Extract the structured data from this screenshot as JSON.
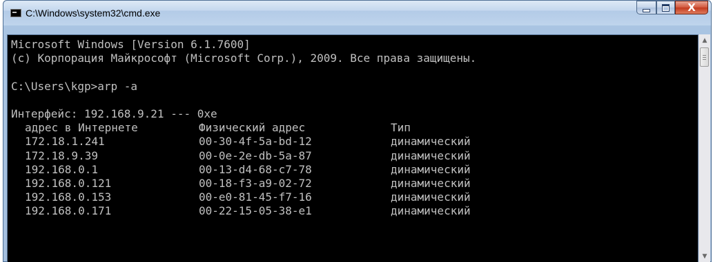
{
  "window": {
    "title": "C:\\Windows\\system32\\cmd.exe",
    "controls": {
      "minimize": "minimize",
      "maximize": "maximize",
      "close": "X"
    }
  },
  "console": {
    "lines": [
      "Microsoft Windows [Version 6.1.7600]",
      "(c) Корпорация Майкрософт (Microsoft Corp.), 2009. Все права защищены.",
      "",
      "C:\\Users\\kgp>arp -a",
      "",
      "Интерфейс: 192.168.9.21 --- 0xe"
    ],
    "arp_table": {
      "headers": [
        "адрес в Интернете",
        "Физический адрес",
        "Тип"
      ],
      "rows": [
        [
          "172.18.1.241",
          "00-30-4f-5a-bd-12",
          "динамический"
        ],
        [
          "172.18.9.39",
          "00-0e-2e-db-5a-87",
          "динамический"
        ],
        [
          "192.168.0.1",
          "00-13-d4-68-c7-78",
          "динамический"
        ],
        [
          "192.168.0.121",
          "00-18-f3-a9-02-72",
          "динамический"
        ],
        [
          "192.168.0.153",
          "00-e0-81-45-f7-16",
          "динамический"
        ],
        [
          "192.168.0.171",
          "00-22-15-05-38-e1",
          "динамический"
        ]
      ]
    }
  },
  "colors": {
    "console_background": "#000000",
    "console_text": "#c0c0c0",
    "close_button": "#c7442a",
    "titlebar": "#bfd4ec"
  },
  "icons": {
    "app": "cmd-app-icon",
    "scroll_up": "arrow-up-icon",
    "scroll_down": "arrow-down-icon"
  }
}
